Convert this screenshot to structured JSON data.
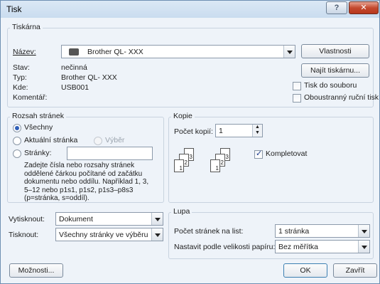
{
  "window": {
    "title": "Tisk"
  },
  "printer": {
    "group_label": "Tiskárna",
    "name_label": "Název:",
    "name_value": "Brother QL- XXX",
    "status_label": "Stav:",
    "status_value": "nečinná",
    "type_label": "Typ:",
    "type_value": "Brother QL- XXX",
    "where_label": "Kde:",
    "where_value": "USB001",
    "comment_label": "Komentář:",
    "properties_button": "Vlastnosti",
    "find_button": "Najít tiskárnu...",
    "print_to_file": "Tisk do souboru",
    "duplex": "Oboustranný ruční tisk"
  },
  "range": {
    "group_label": "Rozsah stránek",
    "all": "Všechny",
    "current": "Aktuální stránka",
    "selection": "Výběr",
    "pages": "Stránky:",
    "pages_value": "",
    "help": [
      "Zadejte čísla nebo rozsahy stránek",
      "oddělené čárkou počítané od začátku",
      "dokumentu nebo oddílu. Například 1, 3,",
      "5–12 nebo p1s1, p1s2, p1s3–p8s3",
      "(p=stránka, s=oddíl)."
    ]
  },
  "copies": {
    "group_label": "Kopie",
    "count_label": "Počet kopií:",
    "count_value": "1",
    "collate": "Kompletovat"
  },
  "bottom": {
    "print_what_label": "Vytisknout:",
    "print_what_value": "Dokument",
    "print_label": "Tisknout:",
    "print_value": "Všechny stránky ve výběru"
  },
  "zoom": {
    "group_label": "Lupa",
    "pages_per_sheet_label": "Počet stránek na list:",
    "pages_per_sheet_value": "1 stránka",
    "scale_label": "Nastavit podle velikosti papíru:",
    "scale_value": "Bez měřítka"
  },
  "footer": {
    "options": "Možnosti...",
    "ok": "OK",
    "close": "Zavřít"
  }
}
